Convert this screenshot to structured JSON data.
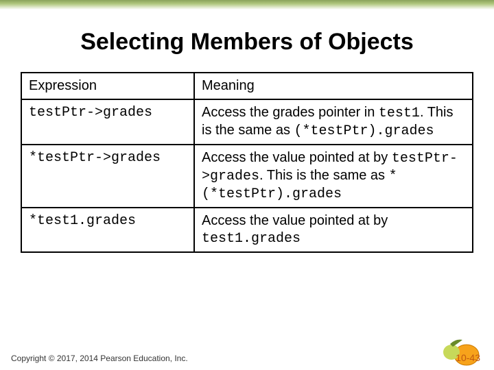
{
  "title": "Selecting Members of Objects",
  "headers": {
    "c0": "Expression",
    "c1": "Meaning"
  },
  "rows": [
    {
      "expr": "testPtr->grades",
      "m0": "Access the grades pointer in ",
      "c0": "test1",
      "m1": ".  This is the same as ",
      "c1": "(*testPtr).grades"
    },
    {
      "expr": "*testPtr->grades",
      "m0": "Access the value pointed at by ",
      "c0": "testPtr->grades",
      "m1": ".  This is the same as ",
      "c1": "*(*testPtr).grades"
    },
    {
      "expr": "*test1.grades",
      "m0": "Access the value pointed at by ",
      "c0": "test1.grades",
      "m1": "",
      "c1": ""
    }
  ],
  "footer": "Copyright © 2017, 2014 Pearson Education, Inc.",
  "page": "10-43"
}
